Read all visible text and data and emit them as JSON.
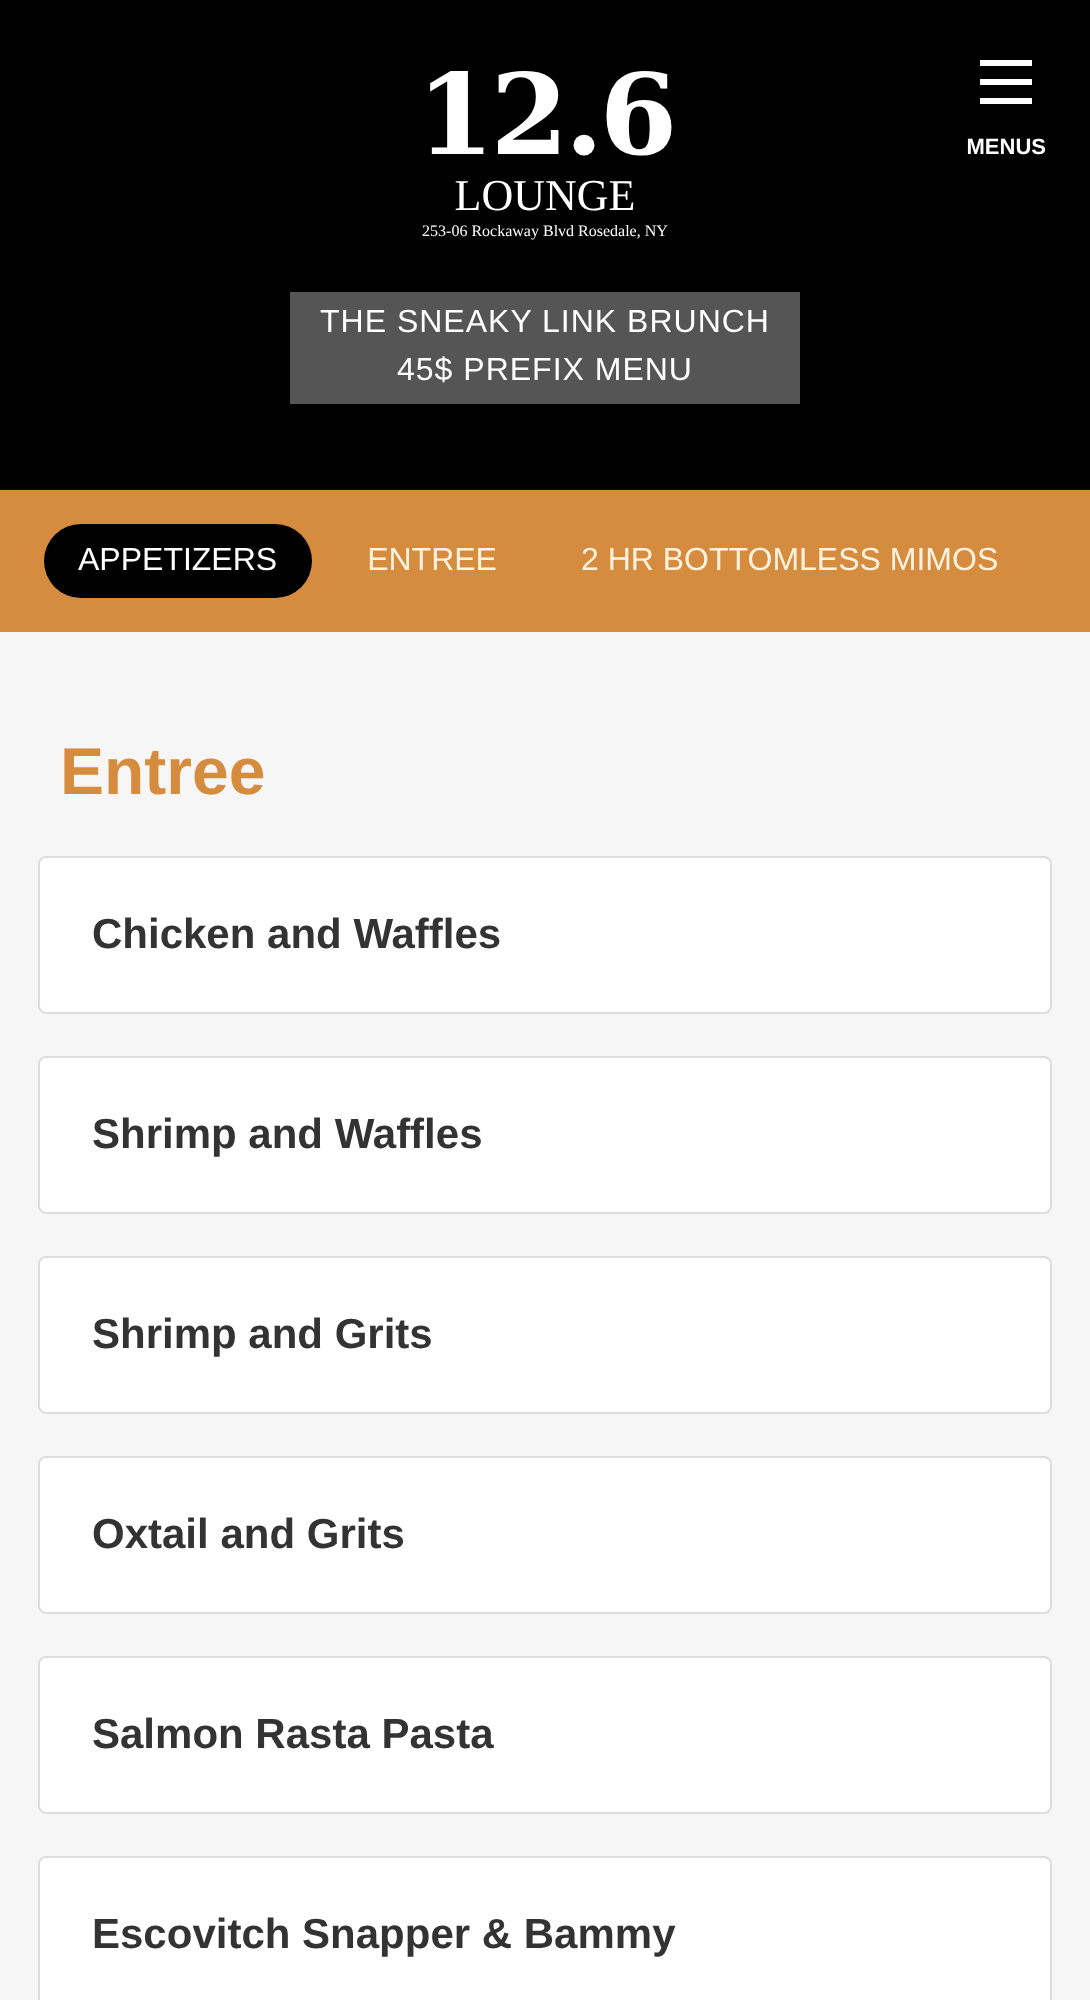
{
  "logo": {
    "mark": "12.6",
    "name": "LOUNGE",
    "address": "253-06 Rockaway Blvd Rosedale, NY"
  },
  "menu_button": {
    "label": "MENUS"
  },
  "banner": {
    "lines": [
      "THE SNEAKY LINK BRUNCH",
      "45$ PREFIX MENU"
    ]
  },
  "tabs": [
    {
      "label": "APPETIZERS",
      "selected": true
    },
    {
      "label": "ENTREE",
      "selected": false
    },
    {
      "label": "2 HR BOTTOMLESS MIMOS",
      "selected": false
    }
  ],
  "section": {
    "title": "Entree",
    "items": [
      "Chicken and Waffles",
      "Shrimp and Waffles",
      "Shrimp and Grits",
      "Oxtail and Grits",
      "Salmon Rasta Pasta",
      "Escovitch Snapper & Bammy"
    ]
  }
}
